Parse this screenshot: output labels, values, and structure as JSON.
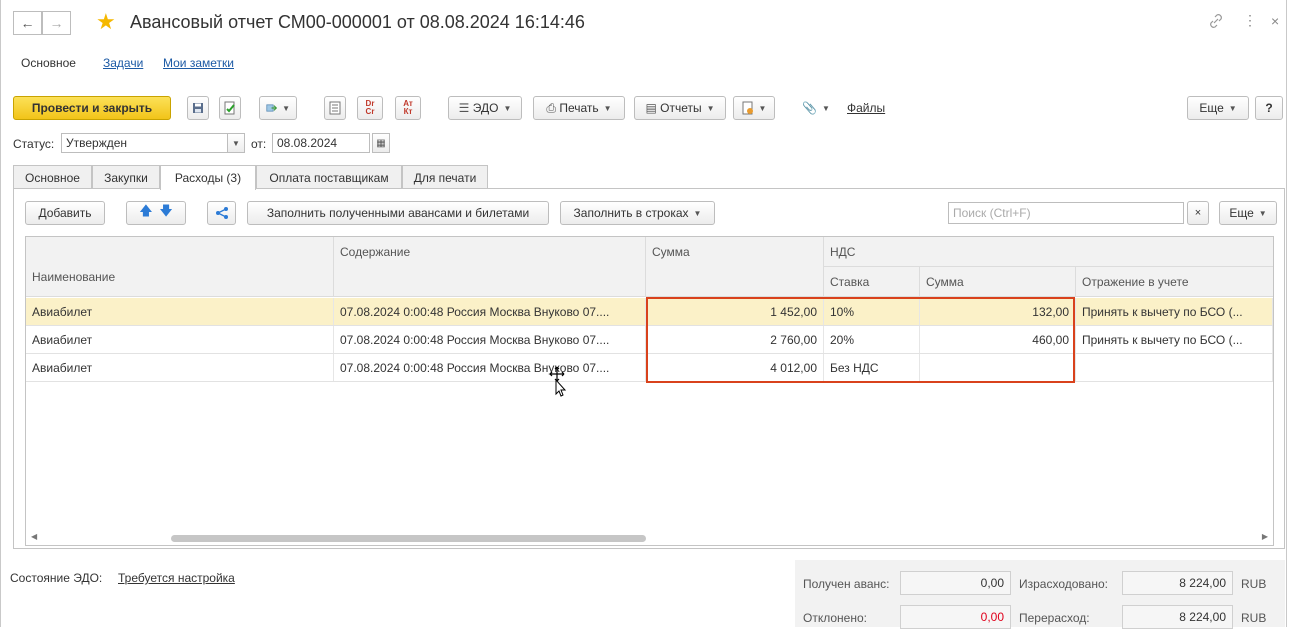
{
  "window": {
    "title": "Авансовый отчет СМ00-000001 от 08.08.2024 16:14:46",
    "back_glyph": "←",
    "forward_glyph": "→",
    "star_glyph": "★",
    "link_glyph": "🔗",
    "more_glyph": "⋮",
    "close_glyph": "×"
  },
  "sections": {
    "main": "Основное",
    "tasks": "Задачи",
    "notes": "Мои заметки"
  },
  "toolbar": {
    "post_close": "Провести и закрыть",
    "dtcr": "Dr Cr",
    "atkt": "Ат Кт",
    "edo": "ЭДО",
    "print": "Печать",
    "reports": "Отчеты",
    "files": "Файлы",
    "more": "Еще",
    "help": "?"
  },
  "status": {
    "label": "Статус:",
    "value": "Утвержден",
    "date_label": "от:",
    "date_value": "08.08.2024"
  },
  "tabs": [
    "Основное",
    "Закупки",
    "Расходы (3)",
    "Оплата поставщикам",
    "Для печати"
  ],
  "table_toolbar": {
    "add": "Добавить",
    "fill_advances": "Заполнить полученными авансами и билетами",
    "fill_rows": "Заполнить в строках",
    "search_placeholder": "Поиск (Ctrl+F)",
    "clear": "×",
    "more": "Еще"
  },
  "columns": {
    "name": "Наименование",
    "content": "Содержание",
    "sum": "Сумма",
    "vat": "НДС",
    "rate": "Ставка",
    "vat_sum": "Сумма",
    "accounting": "Отражение в учете"
  },
  "rows": [
    {
      "name": "Авиабилет",
      "content": "07.08.2024 0:00:48 Россия Москва Внуково 07....",
      "sum": "1 452,00",
      "rate": "10%",
      "vat_sum": "132,00",
      "accounting": "Принять к вычету по БСО (..."
    },
    {
      "name": "Авиабилет",
      "content": "07.08.2024 0:00:48 Россия Москва Внуково 07....",
      "sum": "2 760,00",
      "rate": "20%",
      "vat_sum": "460,00",
      "accounting": "Принять к вычету по БСО (..."
    },
    {
      "name": "Авиабилет",
      "content": "07.08.2024 0:00:48 Россия Москва Внуково 07....",
      "sum": "4 012,00",
      "rate": "Без НДС",
      "vat_sum": "",
      "accounting": ""
    }
  ],
  "footer": {
    "edo_label": "Состояние ЭДО:",
    "edo_link": "Требуется настройка",
    "advance_label": "Получен аванс:",
    "advance_value": "0,00",
    "spent_label": "Израсходовано:",
    "spent_value": "8 224,00",
    "currency1": "RUB",
    "rejected_label": "Отклонено:",
    "rejected_value": "0,00",
    "overspent_label": "Перерасход:",
    "overspent_value": "8 224,00",
    "currency2": "RUB"
  },
  "colors": {
    "primary_button": "#f5cd2a",
    "selected_row": "#fbf1c8",
    "highlight_border": "#d9421c",
    "link": "#1c5aa5",
    "rejected_value": "#e0001b"
  }
}
